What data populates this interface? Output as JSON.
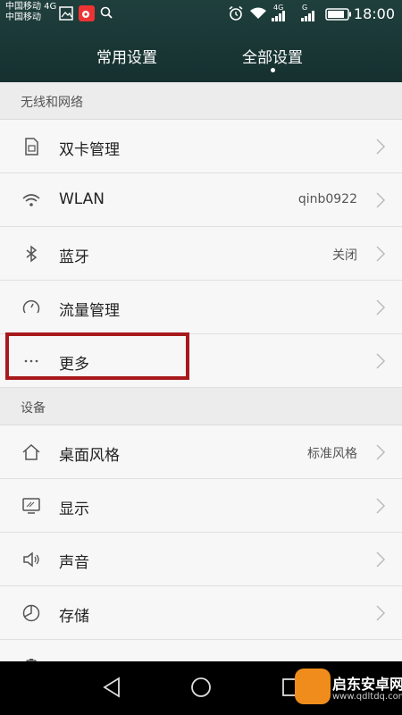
{
  "status_bar": {
    "carrier_1": "中国移动 4G",
    "carrier_2": "中国移动",
    "network_1": "4G",
    "network_2": "G",
    "time": "18:00"
  },
  "tabs": [
    {
      "label": "常用设置",
      "active": false
    },
    {
      "label": "全部设置",
      "active": true
    }
  ],
  "sections": [
    {
      "header": "无线和网络",
      "items": [
        {
          "label": "双卡管理",
          "value": "",
          "icon": "sim-card-icon"
        },
        {
          "label": "WLAN",
          "value": "qinb0922",
          "icon": "wifi-icon"
        },
        {
          "label": "蓝牙",
          "value": "关闭",
          "icon": "bluetooth-icon"
        },
        {
          "label": "流量管理",
          "value": "",
          "icon": "data-usage-icon"
        },
        {
          "label": "更多",
          "value": "",
          "icon": "more-dots-icon"
        }
      ]
    },
    {
      "header": "设备",
      "items": [
        {
          "label": "桌面风格",
          "value": "标准风格",
          "icon": "home-icon"
        },
        {
          "label": "显示",
          "value": "",
          "icon": "display-icon"
        },
        {
          "label": "声音",
          "value": "",
          "icon": "speaker-icon"
        },
        {
          "label": "存储",
          "value": "",
          "icon": "storage-pie-icon"
        }
      ]
    }
  ],
  "watermark": {
    "name": "启东安卓网",
    "url": "www.qdltdq.com"
  },
  "colors": {
    "header_bg": "#1f3f3d",
    "highlight": "#a8191c",
    "nav_bg": "#000000"
  }
}
